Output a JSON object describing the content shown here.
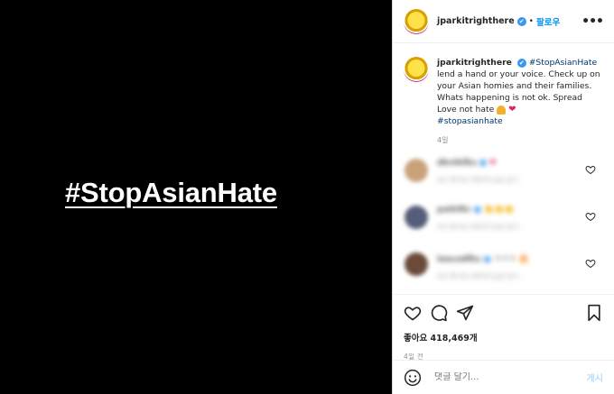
{
  "media": {
    "hashtag_text": "#StopAsianHate"
  },
  "header": {
    "username": "jparkitrighthere",
    "verified_mark": "✔",
    "separator": "•",
    "follow_label": "팔로우",
    "more_label": "•••"
  },
  "caption": {
    "username": "jparkitrighthere",
    "verified_mark": "✔",
    "tag1": "#StopAsianHate",
    "text": "lend a hand or your voice. Check up on your Asian homies and their families. Whats happening is not ok. Spread Love not hate",
    "heart": "❤",
    "tag2": "#stopasianhate",
    "time": "4일"
  },
  "comments": [
    {
      "username": "dkvtkfks",
      "text": "❤",
      "meta": "4년   좋아요 000개   답글 달기",
      "avatar_color": "#c9a27a"
    },
    {
      "username": "pothfkr",
      "text": "👏👏👏",
      "meta": "4년   좋아요 000개   답글 달기",
      "avatar_color": "#555d7a"
    },
    {
      "username": "leecodfks",
      "text": "ㅋㅋㅋ 🔥",
      "meta": "4년   좋아요 000개   답글 달기",
      "avatar_color": "#6b4a3a"
    }
  ],
  "actions": {
    "likes_label": "좋아요",
    "likes_count": "418,469개",
    "time_ago": "4일 전"
  },
  "comment_box": {
    "placeholder": "댓글 달기...",
    "post_label": "게시"
  },
  "colors": {
    "accent": "#0095f6",
    "verified": "#3897f0",
    "hashtag": "#00376b",
    "media_bg": "#000000"
  }
}
